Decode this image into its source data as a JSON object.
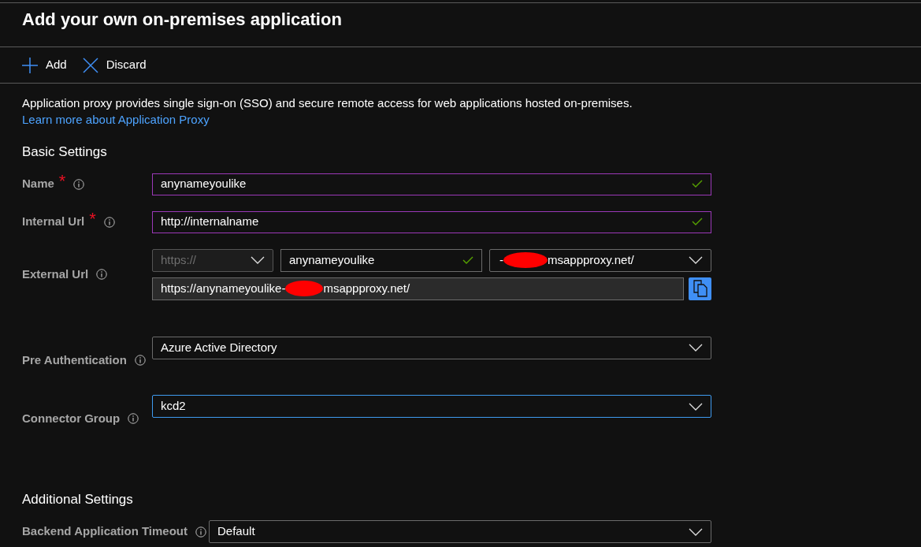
{
  "title": "Add your own on-premises application",
  "toolbar": [
    {
      "label": "Add",
      "kind": "add"
    },
    {
      "label": "Discard",
      "kind": "discard"
    }
  ],
  "description": {
    "text": "Application proxy provides single sign-on (SSO) and secure remote access for web applications hosted on-premises.",
    "link": "Learn more about Application Proxy"
  },
  "sections": [
    {
      "heading": "Basic Settings",
      "fields": [
        {
          "kind": "text",
          "label": "Name",
          "required_mark": "*",
          "value": "anynameyoulike",
          "valid": true,
          "modified": true
        },
        {
          "kind": "text",
          "label": "Internal Url",
          "required_mark": "*",
          "value": "http://internalname",
          "valid": true,
          "modified": true
        },
        {
          "kind": "external_url",
          "label": "External Url",
          "scheme": {
            "value": "https://",
            "disabled": true
          },
          "host": {
            "value": "anynameyoulike",
            "valid": true
          },
          "domain": {
            "before": "-",
            "after": "msappproxy.net/"
          },
          "full_url": {
            "before": "https://anynameyoulike-",
            "after": "msappproxy.net/"
          }
        },
        {
          "kind": "dropdown",
          "label": "Pre Authentication",
          "value": "Azure Active Directory",
          "focused": false
        },
        {
          "kind": "dropdown",
          "label": "Connector Group",
          "value": "kcd2",
          "focused": true
        }
      ]
    },
    {
      "heading": "Additional Settings",
      "fields": [
        {
          "kind": "dropdown",
          "label": "Backend Application Timeout",
          "value": "Default",
          "focused": false
        }
      ]
    }
  ]
}
